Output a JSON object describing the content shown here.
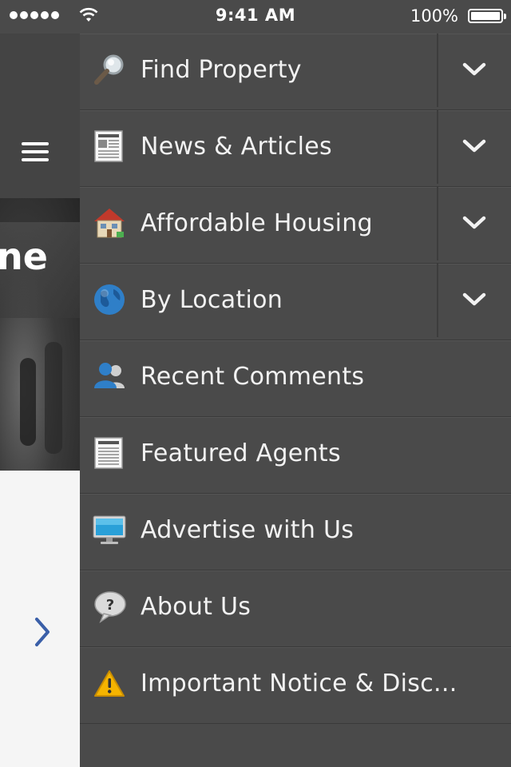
{
  "status_bar": {
    "time": "9:41 AM",
    "battery": "100%",
    "signal_icon": "signal-dots-icon",
    "wifi_icon": "wifi-icon",
    "battery_icon": "battery-icon"
  },
  "background_app": {
    "hero_text": "ne",
    "menu_icon": "hamburger-icon",
    "next_icon": "chevron-right-icon",
    "colors": {
      "chevron": "#3a5fa8",
      "content_bg": "#f5f5f5"
    }
  },
  "menu": {
    "items": [
      {
        "label": "Find Property",
        "icon": "magnifier-icon",
        "expandable": true
      },
      {
        "label": "News & Articles",
        "icon": "newspaper-icon",
        "expandable": true
      },
      {
        "label": "Affordable Housing",
        "icon": "house-icon",
        "expandable": true
      },
      {
        "label": "By Location",
        "icon": "globe-icon",
        "expandable": true
      },
      {
        "label": "Recent Comments",
        "icon": "users-icon",
        "expandable": false
      },
      {
        "label": "Featured Agents",
        "icon": "document-icon",
        "expandable": false
      },
      {
        "label": "Advertise with Us",
        "icon": "monitor-icon",
        "expandable": false
      },
      {
        "label": "About Us",
        "icon": "question-bubble-icon",
        "expandable": false
      },
      {
        "label": "Important Notice & Disc...",
        "icon": "warning-icon",
        "expandable": false
      }
    ],
    "colors": {
      "background": "#4a4a4a",
      "text": "#f2f2f2",
      "separator": "#3a3a3a"
    }
  }
}
